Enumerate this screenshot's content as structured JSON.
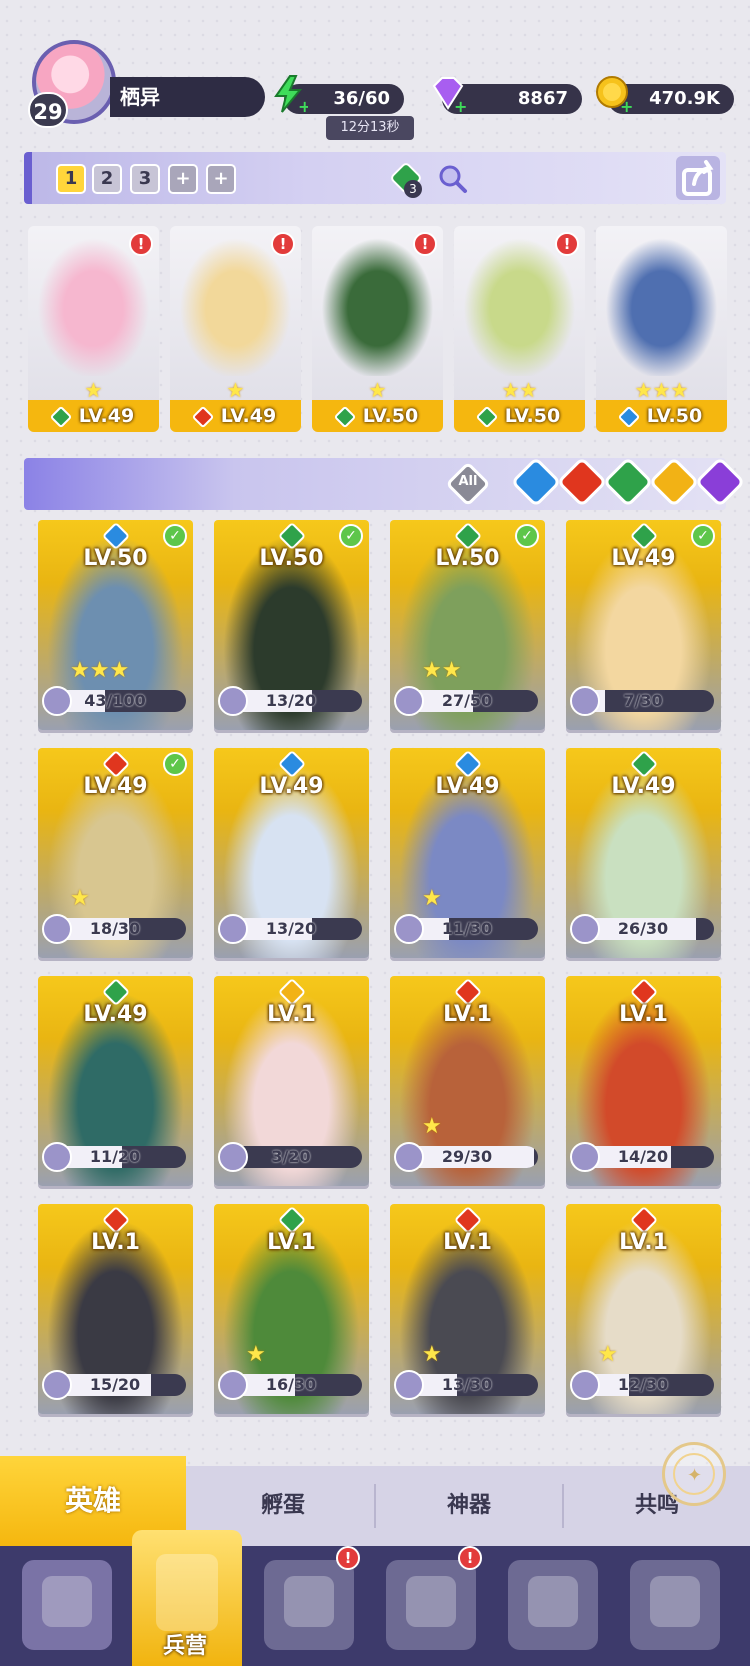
{
  "player": {
    "level": "29",
    "name": "栖异"
  },
  "resources": {
    "energy": "36/60",
    "energy_timer": "12分13秒",
    "gems": "8867",
    "gold": "470.9K"
  },
  "team_slots": [
    "1",
    "2",
    "3",
    "+",
    "+"
  ],
  "element_token_count": "3",
  "team": [
    {
      "level": "LV.49",
      "element": "wind",
      "stars": "★",
      "alert": "!"
    },
    {
      "level": "LV.49",
      "element": "fire",
      "stars": "★",
      "alert": "!"
    },
    {
      "level": "LV.50",
      "element": "wind",
      "stars": "★",
      "alert": "!"
    },
    {
      "level": "LV.50",
      "element": "wind",
      "stars": "★★",
      "alert": "!"
    },
    {
      "level": "LV.50",
      "element": "water",
      "stars": "★★★",
      "alert": ""
    }
  ],
  "filters": {
    "all_label": "All",
    "elements": [
      "water",
      "fire",
      "wind",
      "light",
      "dark"
    ]
  },
  "heroes": [
    {
      "level": "LV.50",
      "element": "water",
      "checked": true,
      "stars": "★★★",
      "shards": "43/100",
      "progress": 0.43
    },
    {
      "level": "LV.50",
      "element": "wind",
      "checked": true,
      "stars": "",
      "shards": "13/20",
      "progress": 0.65
    },
    {
      "level": "LV.50",
      "element": "wind",
      "checked": true,
      "stars": "★★",
      "shards": "27/50",
      "progress": 0.54
    },
    {
      "level": "LV.49",
      "element": "wind",
      "checked": true,
      "stars": "",
      "shards": "7/30",
      "progress": 0.23
    },
    {
      "level": "LV.49",
      "element": "fire",
      "checked": true,
      "stars": "★",
      "shards": "18/30",
      "progress": 0.6
    },
    {
      "level": "LV.49",
      "element": "water",
      "checked": false,
      "stars": "",
      "shards": "13/20",
      "progress": 0.65
    },
    {
      "level": "LV.49",
      "element": "water",
      "checked": false,
      "stars": "★",
      "shards": "11/30",
      "progress": 0.37
    },
    {
      "level": "LV.49",
      "element": "wind",
      "checked": false,
      "stars": "",
      "shards": "26/30",
      "progress": 0.87
    },
    {
      "level": "LV.49",
      "element": "wind",
      "checked": false,
      "stars": "",
      "shards": "11/20",
      "progress": 0.55
    },
    {
      "level": "LV.1",
      "element": "light",
      "checked": false,
      "stars": "",
      "shards": "3/20",
      "progress": 0.15
    },
    {
      "level": "LV.1",
      "element": "fire",
      "checked": false,
      "stars": "★",
      "shards": "29/30",
      "progress": 0.97
    },
    {
      "level": "LV.1",
      "element": "fire",
      "checked": false,
      "stars": "",
      "shards": "14/20",
      "progress": 0.7
    },
    {
      "level": "LV.1",
      "element": "fire",
      "checked": false,
      "stars": "",
      "shards": "15/20",
      "progress": 0.75
    },
    {
      "level": "LV.1",
      "element": "wind",
      "checked": false,
      "stars": "★",
      "shards": "16/30",
      "progress": 0.53
    },
    {
      "level": "LV.1",
      "element": "fire",
      "checked": false,
      "stars": "★",
      "shards": "13/30",
      "progress": 0.43
    },
    {
      "level": "LV.1",
      "element": "fire",
      "checked": false,
      "stars": "★",
      "shards": "12/30",
      "progress": 0.4
    }
  ],
  "sub_tabs": [
    "英雄",
    "孵蛋",
    "神器",
    "共鸣"
  ],
  "bottom_nav": {
    "active_label": "兵营",
    "items": [
      "cards-icon",
      "barracks-icon",
      "book-icon",
      "shrine-icon",
      "mushroom-icon",
      "banner-icon"
    ]
  },
  "colors": {
    "water": "#2a8be0",
    "fire": "#e0361e",
    "wind": "#2fa24a",
    "light": "#f2b215",
    "dark": "#8a3ed8",
    "accent": "#6a5fd0"
  }
}
